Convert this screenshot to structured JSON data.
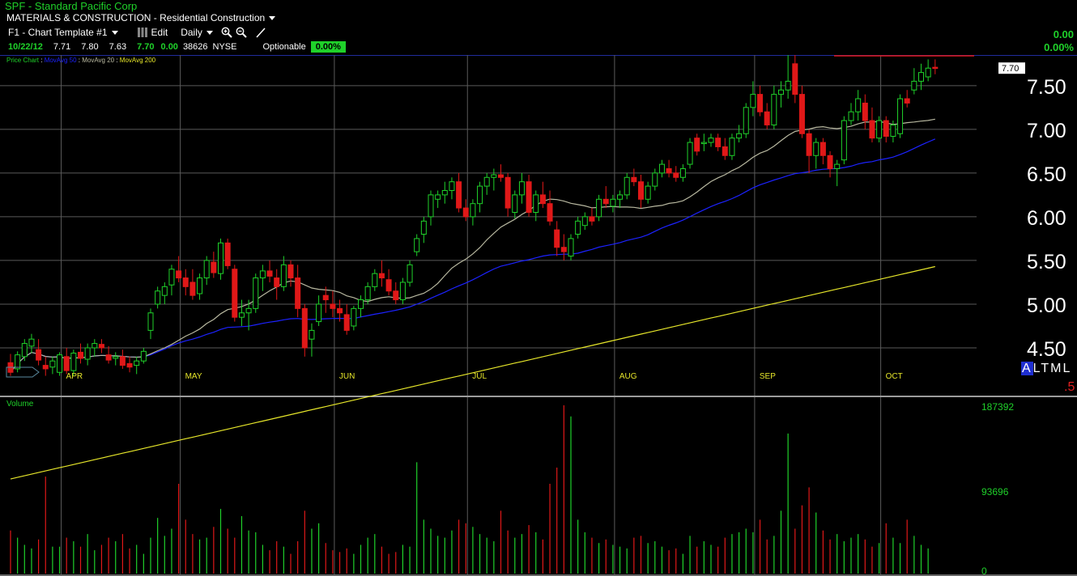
{
  "header": {
    "title": "SPF - Standard Pacific Corp",
    "sector": "MATERIALS & CONSTRUCTION - Residential Construction",
    "template": "F1 - Chart Template #1",
    "edit_label": "Edit",
    "period": "Daily",
    "quote": {
      "date": "10/22/12",
      "open": "7.71",
      "high": "7.80",
      "low": "7.63",
      "last": "7.70",
      "change": "0.00",
      "volume": "38626",
      "exchange": "NYSE"
    },
    "optionable_label": "Optionable",
    "optionable_value": "0.00%",
    "right_change": "0.00",
    "right_change_pct": "0.00%"
  },
  "price_panel": {
    "legend": [
      "Price Chart",
      "MovAvg 50",
      "MovAvg 20",
      "MovAvg 200"
    ],
    "last_price_tag": "7.70",
    "y_ticks": [
      "7.50",
      "7.00",
      "6.50",
      "6.00",
      "5.50",
      "5.00",
      "4.50"
    ],
    "months": [
      "APR",
      "MAY",
      "JUN",
      "JUL",
      "AUG",
      "SEP",
      "OCT"
    ],
    "altml": "ALTML",
    "altml_suffix": ".5"
  },
  "volume_panel": {
    "label": "Volume",
    "y_ticks": [
      "187392",
      "93696",
      "0"
    ]
  },
  "colors": {
    "up": "#1fd12a",
    "down": "#e01818",
    "ma50": "#1c22ff",
    "ma20": "#b8b8a0",
    "ma200": "#e6e62a",
    "grid": "#5a5a5a"
  },
  "chart_data": {
    "type": "candlestick",
    "symbol": "SPF",
    "y_range": [
      4.25,
      7.85
    ],
    "volume_range": [
      0,
      187392
    ],
    "months": [
      "APR",
      "MAY",
      "JUN",
      "JUL",
      "AUG",
      "SEP",
      "OCT"
    ],
    "ohlc": [
      [
        4.33,
        4.43,
        4.18,
        4.22
      ],
      [
        4.26,
        4.46,
        4.22,
        4.42
      ],
      [
        4.4,
        4.6,
        4.35,
        4.55
      ],
      [
        4.52,
        4.66,
        4.44,
        4.6
      ],
      [
        4.48,
        4.6,
        4.3,
        4.36
      ],
      [
        4.3,
        4.4,
        4.18,
        4.26
      ],
      [
        4.28,
        4.4,
        4.2,
        4.35
      ],
      [
        4.22,
        4.45,
        4.18,
        4.42
      ],
      [
        4.4,
        4.5,
        4.2,
        4.24
      ],
      [
        4.24,
        4.48,
        4.18,
        4.44
      ],
      [
        4.45,
        4.55,
        4.32,
        4.38
      ],
      [
        4.37,
        4.55,
        4.3,
        4.5
      ],
      [
        4.5,
        4.6,
        4.4,
        4.55
      ],
      [
        4.54,
        4.6,
        4.44,
        4.5
      ],
      [
        4.42,
        4.52,
        4.32,
        4.36
      ],
      [
        4.38,
        4.45,
        4.3,
        4.4
      ],
      [
        4.4,
        4.48,
        4.26,
        4.3
      ],
      [
        4.32,
        4.4,
        4.22,
        4.28
      ],
      [
        4.3,
        4.4,
        4.2,
        4.35
      ],
      [
        4.35,
        4.5,
        4.32,
        4.46
      ],
      [
        4.7,
        4.95,
        4.6,
        4.9
      ],
      [
        5.0,
        5.2,
        4.95,
        5.15
      ],
      [
        5.1,
        5.25,
        5.0,
        5.2
      ],
      [
        5.22,
        5.45,
        5.1,
        5.4
      ],
      [
        5.38,
        5.55,
        5.25,
        5.3
      ],
      [
        5.3,
        5.4,
        5.1,
        5.2
      ],
      [
        5.25,
        5.4,
        5.05,
        5.1
      ],
      [
        5.12,
        5.35,
        5.05,
        5.3
      ],
      [
        5.3,
        5.55,
        5.22,
        5.5
      ],
      [
        5.48,
        5.6,
        5.3,
        5.36
      ],
      [
        5.35,
        5.75,
        5.28,
        5.7
      ],
      [
        5.7,
        5.75,
        5.4,
        5.44
      ],
      [
        5.4,
        5.45,
        4.8,
        4.85
      ],
      [
        4.85,
        5.05,
        4.75,
        4.9
      ],
      [
        4.9,
        5.05,
        4.7,
        4.95
      ],
      [
        4.95,
        5.35,
        4.9,
        5.3
      ],
      [
        5.3,
        5.45,
        5.15,
        5.38
      ],
      [
        5.38,
        5.5,
        5.25,
        5.32
      ],
      [
        5.3,
        5.4,
        5.05,
        5.2
      ],
      [
        5.2,
        5.55,
        5.15,
        5.45
      ],
      [
        5.45,
        5.5,
        5.2,
        5.3
      ],
      [
        5.3,
        5.45,
        4.85,
        4.95
      ],
      [
        4.95,
        5.0,
        4.4,
        4.5
      ],
      [
        4.6,
        4.78,
        4.4,
        4.7
      ],
      [
        4.8,
        5.1,
        4.75,
        5.0
      ],
      [
        5.1,
        5.2,
        4.9,
        5.05
      ],
      [
        5.0,
        5.15,
        4.85,
        4.95
      ],
      [
        4.95,
        5.05,
        4.8,
        4.9
      ],
      [
        4.88,
        5.0,
        4.65,
        4.7
      ],
      [
        4.75,
        4.98,
        4.7,
        4.95
      ],
      [
        4.95,
        5.1,
        4.85,
        5.05
      ],
      [
        5.05,
        5.25,
        5.0,
        5.2
      ],
      [
        5.2,
        5.4,
        5.15,
        5.35
      ],
      [
        5.35,
        5.5,
        5.2,
        5.3
      ],
      [
        5.28,
        5.4,
        5.1,
        5.15
      ],
      [
        5.15,
        5.25,
        5.0,
        5.05
      ],
      [
        5.05,
        5.3,
        5.0,
        5.25
      ],
      [
        5.25,
        5.5,
        5.2,
        5.45
      ],
      [
        5.6,
        5.8,
        5.55,
        5.75
      ],
      [
        5.8,
        6.0,
        5.7,
        5.95
      ],
      [
        6.0,
        6.3,
        5.9,
        6.25
      ],
      [
        6.2,
        6.3,
        6.1,
        6.25
      ],
      [
        6.25,
        6.4,
        6.15,
        6.3
      ],
      [
        6.3,
        6.45,
        6.2,
        6.4
      ],
      [
        6.4,
        6.5,
        6.05,
        6.1
      ],
      [
        6.1,
        6.2,
        5.95,
        6.0
      ],
      [
        6.0,
        6.2,
        5.9,
        6.15
      ],
      [
        6.15,
        6.4,
        6.05,
        6.35
      ],
      [
        6.35,
        6.5,
        6.25,
        6.45
      ],
      [
        6.45,
        6.55,
        6.3,
        6.48
      ],
      [
        6.48,
        6.6,
        6.4,
        6.45
      ],
      [
        6.45,
        6.5,
        6.0,
        6.1
      ],
      [
        6.05,
        6.3,
        5.98,
        6.25
      ],
      [
        6.25,
        6.5,
        6.15,
        6.4
      ],
      [
        6.4,
        6.48,
        6.0,
        6.05
      ],
      [
        6.05,
        6.3,
        5.95,
        6.25
      ],
      [
        6.25,
        6.4,
        6.1,
        6.15
      ],
      [
        6.15,
        6.3,
        5.9,
        5.95
      ],
      [
        5.85,
        5.95,
        5.55,
        5.65
      ],
      [
        5.65,
        5.8,
        5.5,
        5.6
      ],
      [
        5.55,
        5.8,
        5.5,
        5.75
      ],
      [
        5.8,
        6.0,
        5.75,
        5.95
      ],
      [
        5.9,
        6.05,
        5.85,
        6.0
      ],
      [
        6.0,
        6.1,
        5.9,
        5.95
      ],
      [
        6.0,
        6.25,
        5.95,
        6.2
      ],
      [
        6.2,
        6.35,
        6.1,
        6.15
      ],
      [
        6.12,
        6.25,
        6.05,
        6.2
      ],
      [
        6.2,
        6.3,
        6.1,
        6.25
      ],
      [
        6.25,
        6.5,
        6.2,
        6.45
      ],
      [
        6.45,
        6.55,
        6.35,
        6.4
      ],
      [
        6.4,
        6.48,
        6.1,
        6.2
      ],
      [
        6.2,
        6.4,
        6.15,
        6.35
      ],
      [
        6.35,
        6.55,
        6.3,
        6.5
      ],
      [
        6.5,
        6.65,
        6.45,
        6.6
      ],
      [
        6.55,
        6.65,
        6.45,
        6.5
      ],
      [
        6.5,
        6.58,
        6.4,
        6.45
      ],
      [
        6.45,
        6.6,
        6.4,
        6.55
      ],
      [
        6.6,
        6.9,
        6.55,
        6.85
      ],
      [
        6.9,
        6.95,
        6.7,
        6.75
      ],
      [
        6.85,
        6.95,
        6.75,
        6.85
      ],
      [
        6.85,
        6.95,
        6.8,
        6.9
      ],
      [
        6.9,
        6.95,
        6.75,
        6.8
      ],
      [
        6.8,
        6.9,
        6.65,
        6.7
      ],
      [
        6.7,
        6.95,
        6.65,
        6.9
      ],
      [
        6.9,
        7.05,
        6.85,
        6.95
      ],
      [
        6.95,
        7.3,
        6.9,
        7.25
      ],
      [
        7.25,
        7.55,
        7.15,
        7.4
      ],
      [
        7.4,
        7.5,
        7.15,
        7.2
      ],
      [
        7.2,
        7.3,
        7.0,
        7.05
      ],
      [
        7.05,
        7.5,
        7.0,
        7.4
      ],
      [
        7.4,
        7.55,
        7.25,
        7.45
      ],
      [
        7.45,
        7.85,
        7.35,
        7.55
      ],
      [
        7.75,
        7.85,
        7.3,
        7.4
      ],
      [
        7.4,
        7.5,
        6.9,
        6.95
      ],
      [
        6.95,
        7.0,
        6.5,
        6.7
      ],
      [
        6.7,
        6.9,
        6.55,
        6.85
      ],
      [
        6.85,
        6.9,
        6.6,
        6.7
      ],
      [
        6.7,
        6.75,
        6.45,
        6.55
      ],
      [
        6.55,
        6.65,
        6.35,
        6.6
      ],
      [
        6.65,
        7.15,
        6.6,
        7.1
      ],
      [
        7.1,
        7.3,
        7.05,
        7.2
      ],
      [
        7.2,
        7.45,
        7.1,
        7.35
      ],
      [
        7.3,
        7.4,
        7.0,
        7.1
      ],
      [
        7.1,
        7.25,
        6.85,
        6.9
      ],
      [
        6.9,
        7.15,
        6.85,
        7.1
      ],
      [
        7.1,
        7.15,
        6.85,
        6.92
      ],
      [
        6.92,
        7.1,
        6.85,
        7.05
      ],
      [
        6.95,
        7.4,
        6.9,
        7.35
      ],
      [
        7.35,
        7.45,
        7.25,
        7.3
      ],
      [
        7.45,
        7.7,
        7.4,
        7.55
      ],
      [
        7.55,
        7.75,
        7.45,
        7.65
      ],
      [
        7.6,
        7.8,
        7.55,
        7.7
      ],
      [
        7.71,
        7.8,
        7.63,
        7.7
      ]
    ],
    "volume": [
      48000,
      40000,
      32000,
      28000,
      38000,
      108000,
      30000,
      30000,
      40000,
      36000,
      30000,
      44000,
      26000,
      32000,
      40000,
      36000,
      44000,
      28000,
      32000,
      22000,
      40000,
      62000,
      42000,
      50000,
      100000,
      60000,
      44000,
      38000,
      40000,
      52000,
      72000,
      50000,
      40000,
      64000,
      48000,
      46000,
      32000,
      26000,
      36000,
      30000,
      22000,
      36000,
      70000,
      50000,
      56000,
      34000,
      26000,
      24000,
      28000,
      22000,
      32000,
      40000,
      44000,
      30000,
      22000,
      24000,
      32000,
      30000,
      124000,
      60000,
      50000,
      42000,
      40000,
      48000,
      60000,
      56000,
      52000,
      44000,
      40000,
      36000,
      70000,
      48000,
      40000,
      44000,
      54000,
      46000,
      38000,
      100000,
      118000,
      187392,
      175000,
      60000,
      46000,
      40000,
      34000,
      38000,
      32000,
      30000,
      28000,
      40000,
      42000,
      34000,
      36000,
      30000,
      26000,
      28000,
      22000,
      42000,
      30000,
      36000,
      32000,
      30000,
      40000,
      44000,
      46000,
      50000,
      46000,
      60000,
      38000,
      42000,
      70000,
      156000,
      50000,
      76000,
      96000,
      68000,
      48000,
      38000,
      44000,
      36000,
      40000,
      44000,
      38000,
      30000,
      34000,
      56000,
      40000,
      34000,
      60000,
      42000,
      32000,
      28000
    ]
  }
}
